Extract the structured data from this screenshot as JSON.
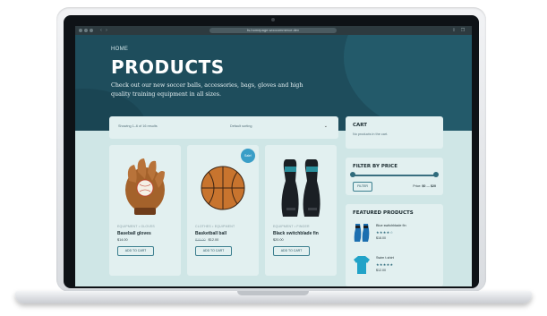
{
  "browser": {
    "url": "ts-homepage.woocommerce.dev"
  },
  "hero": {
    "breadcrumb": "HOME",
    "title": "PRODUCTS",
    "description": "Check out our new soccer balls, accessories, bags, gloves and high quality training equipment in all sizes."
  },
  "toolbar": {
    "result_count": "Showing 1–6 of 16 results",
    "sort_selected": "Default sorting"
  },
  "products": [
    {
      "category": "EQUIPMENT • GLOVES",
      "name": "Baseball gloves",
      "price": "$14.00",
      "old_price": "",
      "button": "ADD TO CART",
      "sale": ""
    },
    {
      "category": "CLOTHES • EQUIPMENT",
      "name": "Basketball ball",
      "price": "$12.00",
      "old_price": "$15.00",
      "button": "ADD TO CART",
      "sale": "Sale!"
    },
    {
      "category": "EQUIPMENT • FINGER",
      "name": "Black switchblade fin",
      "price": "$20.00",
      "old_price": "",
      "button": "ADD TO CART",
      "sale": ""
    }
  ],
  "sidebar": {
    "cart": {
      "title": "CART",
      "empty_text": "No products in the cart."
    },
    "filter": {
      "title": "FILTER BY PRICE",
      "button": "FILTER",
      "price_label": "Price:",
      "price_min": "$0",
      "price_max": "$20",
      "min_fraction": 0,
      "max_fraction": 1
    },
    "featured": {
      "title": "FEATURED PRODUCTS",
      "items": [
        {
          "name": "Blue switchblade fin",
          "stars": "★★★★☆",
          "price": "$18.00"
        },
        {
          "name": "Swim t-shirt",
          "stars": "★★★★★",
          "price": "$12.00"
        }
      ]
    }
  },
  "colors": {
    "hero_bg": "#1e4d5c",
    "page_bg": "#cfe6e6",
    "card_bg": "#e2f0f0",
    "accent": "#3a9ec7"
  }
}
